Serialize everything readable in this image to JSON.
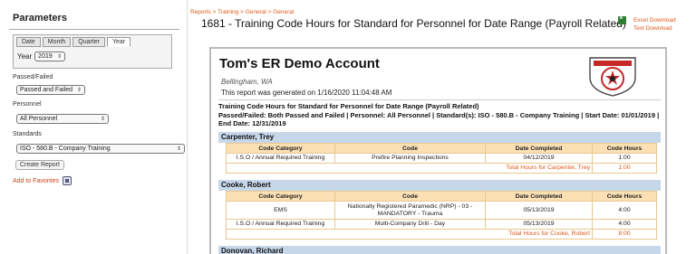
{
  "sidebar": {
    "title": "Parameters",
    "tabs": [
      "Date",
      "Month",
      "Quarter",
      "Year"
    ],
    "active_tab": "Year",
    "year_label": "Year",
    "year_value": "2019",
    "passed_failed_label": "Passed/Failed",
    "passed_failed_value": "Passed and Failed",
    "personnel_label": "Personnel",
    "personnel_value": "All Personnel",
    "standards_label": "Standards",
    "standards_value": "ISO - 580.B - Company Training",
    "create_report_label": "Create Report",
    "favorites_label": "Add to Favorites"
  },
  "breadcrumb": "Reports > Training > General > General",
  "page_title": "1681 - Training Code Hours for Standard for Personnel for Date Range (Payroll Related)",
  "exports": {
    "excel": "Excel Download",
    "text": "Text Download"
  },
  "report": {
    "account": "Tom's ER Demo Account",
    "location": "Bellingham, WA",
    "generated": "This report was generated on 1/16/2020 11:04:48 AM",
    "title": "Training Code Hours for Standard for Personnel for Date Range (Payroll Related)",
    "filters": "Passed/Failed: Both Passed and Failed | Personnel: All Personnel | Standard(s): ISO - 580.B - Company Training | Start Date: 01/01/2019 | End Date: 12/31/2019",
    "columns": [
      "Code Category",
      "Code",
      "Date Completed",
      "Code Hours"
    ],
    "groups": [
      {
        "name": "Carpenter, Trey",
        "rows": [
          {
            "category": "I.S.O / Annual Required Training",
            "code": "Prefire Planning Inspections",
            "date": "04/12/2019",
            "hours": "1:00"
          }
        ],
        "total_label": "Total Hours for Carpenter, Trey",
        "total": "1:00"
      },
      {
        "name": "Cooke, Robert",
        "rows": [
          {
            "category": "EMS",
            "code": "Nationally Registered Paramedic (NRP) - 03 - MANDATORY - Trauma",
            "date": "05/13/2019",
            "hours": "4:00"
          },
          {
            "category": "I.S.O / Annual Required Training",
            "code": "Multi-Company Drill - Day",
            "date": "05/13/2019",
            "hours": "4:00"
          }
        ],
        "total_label": "Total Hours for Cooke, Robert",
        "total": "8:00"
      },
      {
        "name": "Donovan, Richard",
        "rows": [],
        "total_label": "",
        "total": ""
      }
    ]
  },
  "colors": {
    "accent": "#e05a1a",
    "group_header": "#c7d7ea",
    "table_header": "#fbe0b4"
  }
}
